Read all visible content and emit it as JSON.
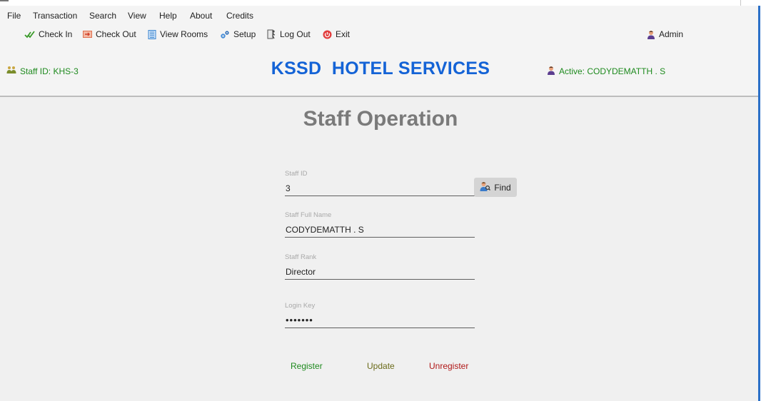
{
  "menu": [
    "File",
    "Transaction",
    "Search",
    "View",
    "Help",
    "About",
    "Credits"
  ],
  "toolbar": {
    "check_in": "Check In",
    "check_out": "Check Out",
    "view_rooms": "View Rooms",
    "setup": "Setup",
    "log_out": "Log Out",
    "exit": "Exit",
    "user": "Admin"
  },
  "header": {
    "staff_id": "Staff ID: KHS-3",
    "brand": "KSSD  HOTEL SERVICES",
    "active": "Active: CODYDEMATTH . S"
  },
  "form": {
    "title": "Staff Operation",
    "staff_id": {
      "label": "Staff ID",
      "value": "3"
    },
    "full_name": {
      "label": "Staff Full Name",
      "value": "CODYDEMATTH . S"
    },
    "rank": {
      "label": "Staff Rank",
      "value": "Director"
    },
    "login_key": {
      "label": "Login Key",
      "value": "•••••••"
    },
    "find_label": "Find"
  },
  "actions": {
    "register": "Register",
    "update": "Update",
    "unregister": "Unregister"
  },
  "colors": {
    "brand": "#1463d6",
    "status_green": "#1e8a1e",
    "update": "#6b6b1a",
    "unregister": "#b01818"
  },
  "icons": {
    "check_in": "check-icon",
    "check_out": "arrow-out-icon",
    "view_rooms": "list-icon",
    "setup": "gear-icon",
    "log_out": "door-exit-icon",
    "exit": "power-icon",
    "user": "user-icon",
    "staff": "staff-group-icon",
    "find": "person-search-icon"
  }
}
